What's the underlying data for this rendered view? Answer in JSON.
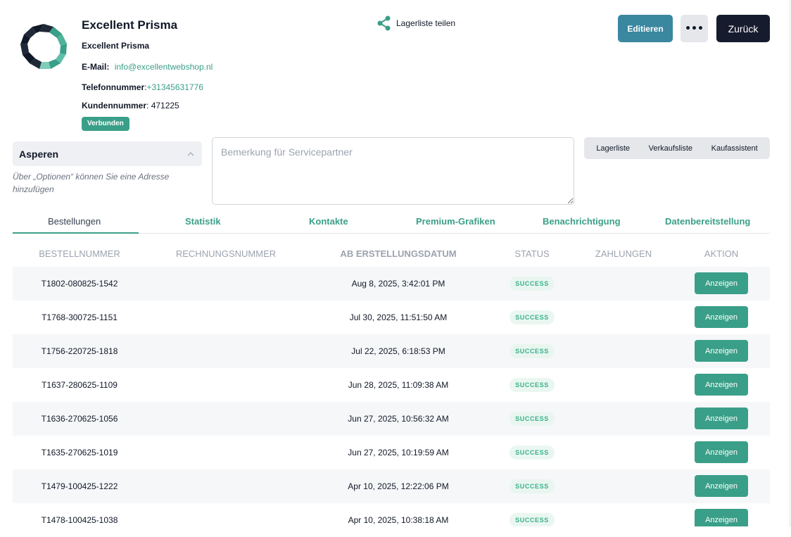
{
  "customer": {
    "title": "Excellent Prisma",
    "subtitle": "Excellent Prisma",
    "email_label": "E-Mail:",
    "email": "info@excellentwebshop.nl",
    "phone_label": "Telefonnummer",
    "phone": "+31345631776",
    "number_label": "Kundennummer",
    "number": "471225",
    "status_badge": "Verbunden"
  },
  "share": {
    "label": "Lagerliste teilen",
    "icon": "share-icon"
  },
  "header_actions": {
    "edit_label": "Editieren",
    "more_label": "•••",
    "back_label": "Zurück"
  },
  "address": {
    "name": "Asperen",
    "hint": "Über „Optionen“ können Sie eine Adresse hinzufügen"
  },
  "remark": {
    "placeholder": "Bemerkung für Servicepartner",
    "value": ""
  },
  "lists": [
    "Lagerliste",
    "Verkaufsliste",
    "Kaufassistent"
  ],
  "tabs": [
    {
      "label": "Bestellungen",
      "active": true
    },
    {
      "label": "Statistik",
      "active": false
    },
    {
      "label": "Kontakte",
      "active": false
    },
    {
      "label": "Premium-Grafiken",
      "active": false
    },
    {
      "label": "Benachrichtigung",
      "active": false
    },
    {
      "label": "Datenbereitstellung",
      "active": false
    }
  ],
  "table": {
    "columns": [
      "BESTELLNUMMER",
      "RECHNUNGSNUMMER",
      "AB ERSTELLUNGSDATUM",
      "STATUS",
      "ZAHLUNGEN",
      "AKTION"
    ],
    "sorted_column": "AB ERSTELLUNGSDATUM",
    "action_label": "Anzeigen",
    "rows": [
      {
        "order": "T1802-080825-1542",
        "invoice": "",
        "created": "Aug 8, 2025, 3:42:01 PM",
        "status": "SUCCESS",
        "payments": ""
      },
      {
        "order": "T1768-300725-1151",
        "invoice": "",
        "created": "Jul 30, 2025, 11:51:50 AM",
        "status": "SUCCESS",
        "payments": ""
      },
      {
        "order": "T1756-220725-1818",
        "invoice": "",
        "created": "Jul 22, 2025, 6:18:53 PM",
        "status": "SUCCESS",
        "payments": ""
      },
      {
        "order": "T1637-280625-1109",
        "invoice": "",
        "created": "Jun 28, 2025, 11:09:38 AM",
        "status": "SUCCESS",
        "payments": ""
      },
      {
        "order": "T1636-270625-1056",
        "invoice": "",
        "created": "Jun 27, 2025, 10:56:32 AM",
        "status": "SUCCESS",
        "payments": ""
      },
      {
        "order": "T1635-270625-1019",
        "invoice": "",
        "created": "Jun 27, 2025, 10:19:59 AM",
        "status": "SUCCESS",
        "payments": ""
      },
      {
        "order": "T1479-100425-1222",
        "invoice": "",
        "created": "Apr 10, 2025, 12:22:06 PM",
        "status": "SUCCESS",
        "payments": ""
      },
      {
        "order": "T1478-100425-1038",
        "invoice": "",
        "created": "Apr 10, 2025, 10:38:18 AM",
        "status": "SUCCESS",
        "payments": ""
      }
    ]
  },
  "colors": {
    "accent": "#3a9f88",
    "edit": "#3a87a0",
    "dark": "#161b2e",
    "success": "#3ab08c"
  }
}
